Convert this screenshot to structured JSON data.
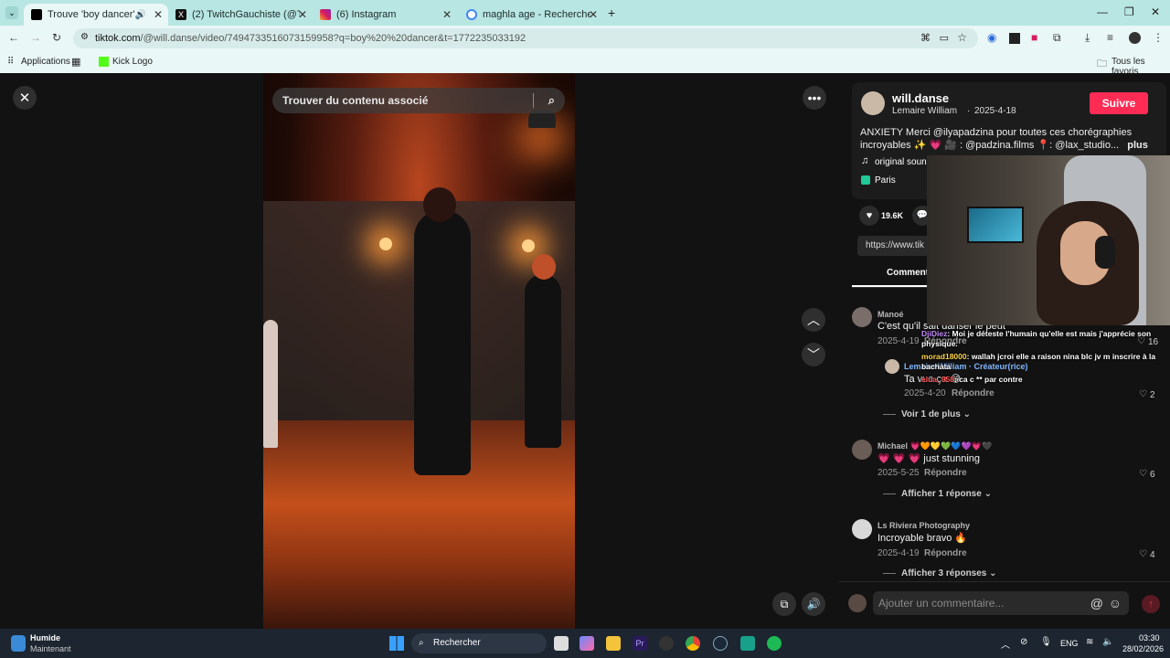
{
  "browser": {
    "tabs": [
      {
        "title": "Trouve 'boy dancer' sur Tik",
        "active": true,
        "favicon": "tiktok-icon"
      },
      {
        "title": "(2) TwitchGauchiste (@TwitchG",
        "active": false,
        "favicon": "x-icon"
      },
      {
        "title": "(6) Instagram",
        "active": false,
        "favicon": "instagram-icon"
      },
      {
        "title": "maghla age - Recherche Googl",
        "active": false,
        "favicon": "google-icon"
      }
    ],
    "url_domain": "tiktok.com",
    "url_path": "/@will.danse/video/7494733516073159958?q=boy%20%20dancer&t=1772235033192",
    "bookmarks": [
      "Applications",
      "Kick Logo"
    ],
    "all_bookmarks": "Tous les favoris"
  },
  "video": {
    "search_placeholder": "Trouver du contenu associé"
  },
  "post": {
    "username": "will.danse",
    "display_name": "Lemaire William",
    "date": "2025-4-18",
    "follow_label": "Suivre",
    "caption_line1": "ANXIETY Merci @ilyapadzina pour toutes ces chorégraphies",
    "caption_line2": "incroyables ✨ 💗 🎥 : @padzina.films 📍: @lax_studio...",
    "more_label": "plus",
    "sound": "original sound",
    "location": "Paris",
    "likes": "19.6K",
    "link": "https://www.tik",
    "comments_tab": "Comment"
  },
  "comments": [
    {
      "name": "Manoé",
      "text": "C'est qu'il sait danser le peut",
      "date": "2025-4-19",
      "reply": "Répondre",
      "likes": "16"
    },
    {
      "name": "Lemaire William · Créateur(rice)",
      "text": "Ta vue ça 😂",
      "date": "2025-4-20",
      "reply": "Répondre",
      "likes": "2",
      "is_reply": true
    },
    {
      "more": "Voir 1 de plus"
    },
    {
      "name": "Michael 💗🧡💛💚💙💜💗🖤",
      "text": "💗 💗 💗 just stunning",
      "date": "2025-5-25",
      "reply": "Répondre",
      "likes": "6"
    },
    {
      "more": "Afficher 1 réponse"
    },
    {
      "name": "Ls Riviera Photography",
      "text": "Incroyable bravo 🔥",
      "date": "2025-4-19",
      "reply": "Répondre",
      "likes": "4"
    },
    {
      "more": "Afficher 3 réponses"
    }
  ],
  "comment_input_placeholder": "Ajouter un commentaire...",
  "stream_chat": [
    {
      "user": "DjiDiez",
      "msg": ": Moi je déteste l'humain qu'elle est mais j'apprécie son physique."
    },
    {
      "user": "morad18000",
      "msg": ": wallah jcroi elle a raison nina blc jv m inscrire à la bachata"
    },
    {
      "user": "elua_958",
      "msg": ": ca c ** par contre"
    }
  ],
  "taskbar": {
    "weather_title": "Humide",
    "weather_sub": "Maintenant",
    "search": "Rechercher",
    "lang": "ENG",
    "time": "03:30",
    "date": "28/02/2026"
  }
}
